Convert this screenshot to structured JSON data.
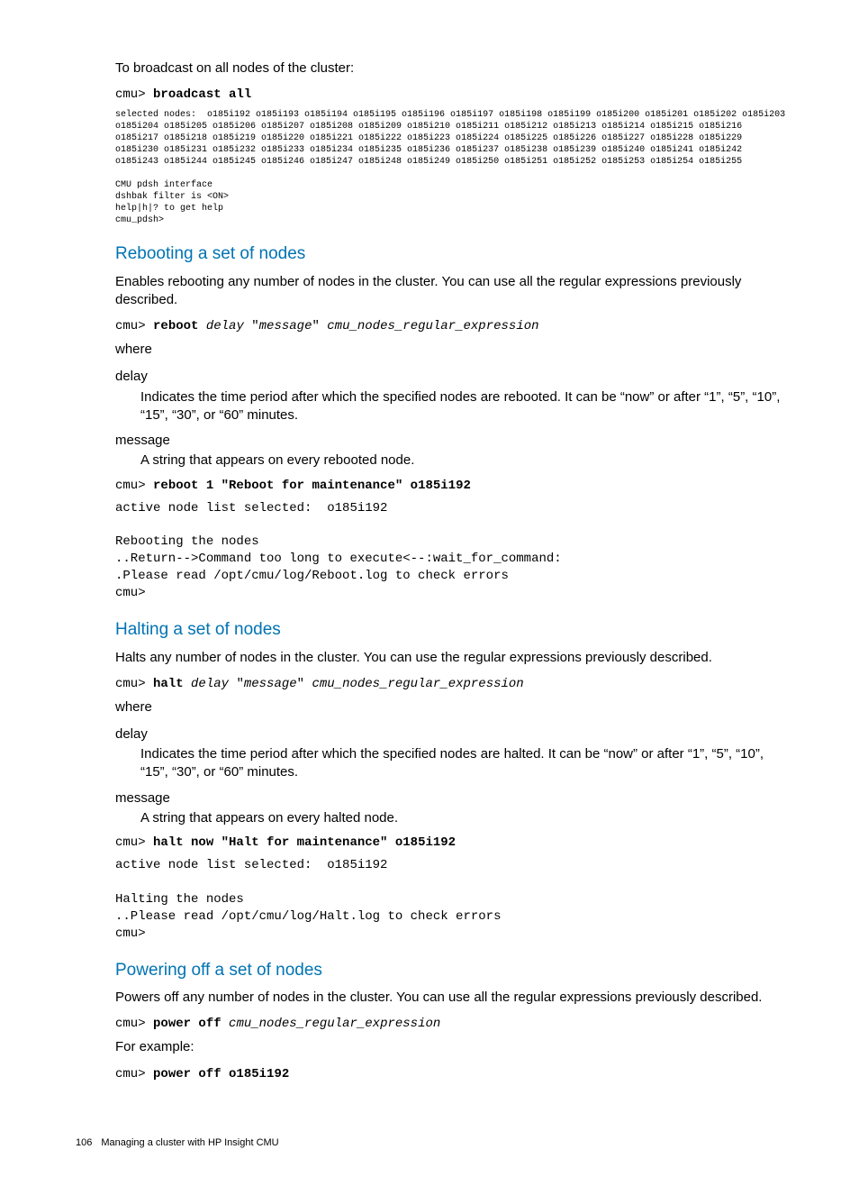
{
  "intro": "To broadcast on all nodes of the cluster:",
  "broadcast_cmd_pre": "cmu> ",
  "broadcast_cmd_bold": "broadcast all",
  "broadcast_output": "selected nodes:  o185i192 o185i193 o185i194 o185i195 o185i196 o185i197 o185i198 o185i199 o185i200 o185i201 o185i202 o185i203 o185i204 o185i205 o185i206 o185i207 o185i208 o185i209 o185i210 o185i211 o185i212 o185i213 o185i214 o185i215 o185i216 o185i217 o185i218 o185i219 o185i220 o185i221 o185i222 o185i223 o185i224 o185i225 o185i226 o185i227 o185i228 o185i229 o185i230 o185i231 o185i232 o185i233 o185i234 o185i235 o185i236 o185i237 o185i238 o185i239 o185i240 o185i241 o185i242 o185i243 o185i244 o185i245 o185i246 o185i247 o185i248 o185i249 o185i250 o185i251 o185i252 o185i253 o185i254 o185i255\n\nCMU pdsh interface\ndshbak filter is <ON>\nhelp|h|? to get help\ncmu_pdsh>",
  "sec1_title": "Rebooting a set of nodes",
  "sec1_desc": "Enables rebooting any number of nodes in the cluster. You can use all the regular expressions previously described.",
  "sec1_syntax_pre": "cmu> ",
  "sec1_syntax_bold": "reboot",
  "sec1_syntax_i1": " delay ",
  "sec1_syntax_q1": "\"",
  "sec1_syntax_i2": "message",
  "sec1_syntax_q2": "\" ",
  "sec1_syntax_i3": "cmu_nodes_regular_expression",
  "where": "where",
  "delay_term": "delay",
  "sec1_delay_def": "Indicates the time period after which the specified nodes are rebooted. It can be “now” or after “1”, “5”, “10”, “15”, “30”, or “60” minutes.",
  "message_term": "message",
  "sec1_msg_def": "A string that appears on every rebooted node.",
  "sec1_ex_pre": "cmu> ",
  "sec1_ex_bold": "reboot 1 \"Reboot for maintenance\" o185i192",
  "sec1_ex_out": "active node list selected:  o185i192\n\nRebooting the nodes\n..Return-->Command too long to execute<--:wait_for_command:\n.Please read /opt/cmu/log/Reboot.log to check errors\ncmu>",
  "sec2_title": "Halting a set of nodes",
  "sec2_desc": "Halts any number of nodes in the cluster. You can use the regular expressions previously described.",
  "sec2_syntax_pre": "cmu> ",
  "sec2_syntax_bold": "halt",
  "sec2_syntax_i1": " delay ",
  "sec2_syntax_q1": "\"",
  "sec2_syntax_i2": "message",
  "sec2_syntax_q2": "\" ",
  "sec2_syntax_i3": "cmu_nodes_regular_expression",
  "sec2_delay_def": "Indicates the time period after which the specified nodes are halted. It can be “now” or after “1”, “5”, “10”, “15”, “30”, or “60” minutes.",
  "sec2_msg_def": "A string that appears on every halted node.",
  "sec2_ex_pre": "cmu> ",
  "sec2_ex_bold": "halt now \"Halt for maintenance\" o185i192",
  "sec2_ex_out": "active node list selected:  o185i192\n\nHalting the nodes\n..Please read /opt/cmu/log/Halt.log to check errors\ncmu>",
  "sec3_title": "Powering off a set of nodes",
  "sec3_desc": "Powers off any number of nodes in the cluster. You can use all the regular expressions previously described.",
  "sec3_syntax_pre": "cmu> ",
  "sec3_syntax_bold": "power off",
  "sec3_syntax_i1": " cmu_nodes_regular_expression",
  "sec3_eg": "For example:",
  "sec3_ex_pre": "cmu> ",
  "sec3_ex_bold": "power off o185i192",
  "footer_page": "106",
  "footer_text": "Managing a cluster with HP Insight CMU"
}
